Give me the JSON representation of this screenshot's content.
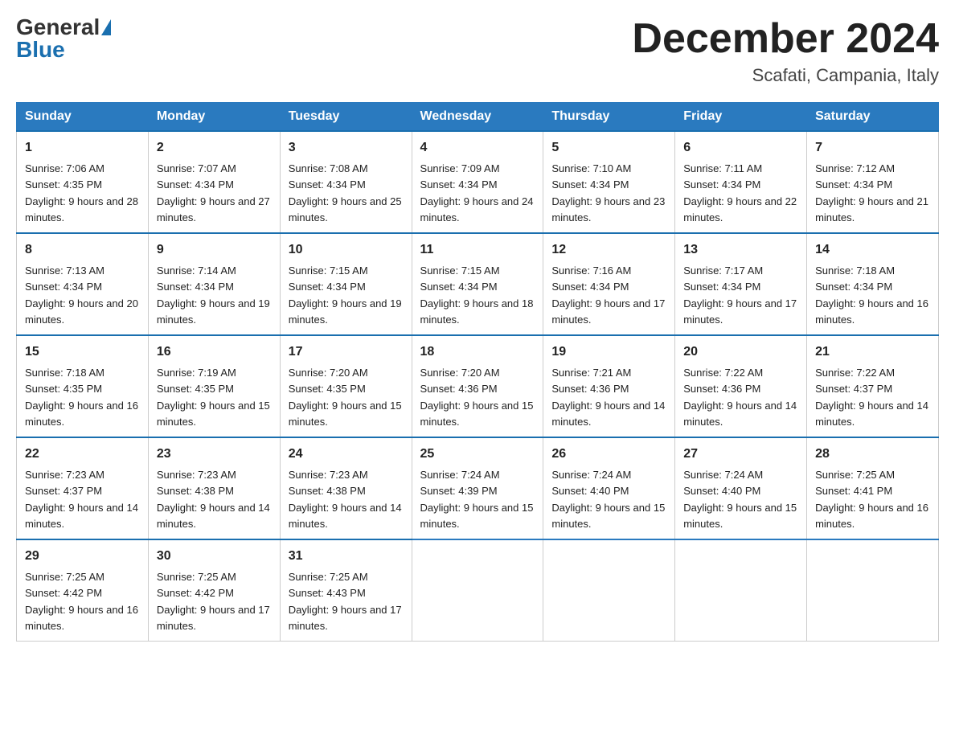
{
  "header": {
    "logo_general": "General",
    "logo_blue": "Blue",
    "month_title": "December 2024",
    "location": "Scafati, Campania, Italy"
  },
  "days_of_week": [
    "Sunday",
    "Monday",
    "Tuesday",
    "Wednesday",
    "Thursday",
    "Friday",
    "Saturday"
  ],
  "weeks": [
    [
      {
        "day": "1",
        "sunrise": "7:06 AM",
        "sunset": "4:35 PM",
        "daylight": "9 hours and 28 minutes."
      },
      {
        "day": "2",
        "sunrise": "7:07 AM",
        "sunset": "4:34 PM",
        "daylight": "9 hours and 27 minutes."
      },
      {
        "day": "3",
        "sunrise": "7:08 AM",
        "sunset": "4:34 PM",
        "daylight": "9 hours and 25 minutes."
      },
      {
        "day": "4",
        "sunrise": "7:09 AM",
        "sunset": "4:34 PM",
        "daylight": "9 hours and 24 minutes."
      },
      {
        "day": "5",
        "sunrise": "7:10 AM",
        "sunset": "4:34 PM",
        "daylight": "9 hours and 23 minutes."
      },
      {
        "day": "6",
        "sunrise": "7:11 AM",
        "sunset": "4:34 PM",
        "daylight": "9 hours and 22 minutes."
      },
      {
        "day": "7",
        "sunrise": "7:12 AM",
        "sunset": "4:34 PM",
        "daylight": "9 hours and 21 minutes."
      }
    ],
    [
      {
        "day": "8",
        "sunrise": "7:13 AM",
        "sunset": "4:34 PM",
        "daylight": "9 hours and 20 minutes."
      },
      {
        "day": "9",
        "sunrise": "7:14 AM",
        "sunset": "4:34 PM",
        "daylight": "9 hours and 19 minutes."
      },
      {
        "day": "10",
        "sunrise": "7:15 AM",
        "sunset": "4:34 PM",
        "daylight": "9 hours and 19 minutes."
      },
      {
        "day": "11",
        "sunrise": "7:15 AM",
        "sunset": "4:34 PM",
        "daylight": "9 hours and 18 minutes."
      },
      {
        "day": "12",
        "sunrise": "7:16 AM",
        "sunset": "4:34 PM",
        "daylight": "9 hours and 17 minutes."
      },
      {
        "day": "13",
        "sunrise": "7:17 AM",
        "sunset": "4:34 PM",
        "daylight": "9 hours and 17 minutes."
      },
      {
        "day": "14",
        "sunrise": "7:18 AM",
        "sunset": "4:34 PM",
        "daylight": "9 hours and 16 minutes."
      }
    ],
    [
      {
        "day": "15",
        "sunrise": "7:18 AM",
        "sunset": "4:35 PM",
        "daylight": "9 hours and 16 minutes."
      },
      {
        "day": "16",
        "sunrise": "7:19 AM",
        "sunset": "4:35 PM",
        "daylight": "9 hours and 15 minutes."
      },
      {
        "day": "17",
        "sunrise": "7:20 AM",
        "sunset": "4:35 PM",
        "daylight": "9 hours and 15 minutes."
      },
      {
        "day": "18",
        "sunrise": "7:20 AM",
        "sunset": "4:36 PM",
        "daylight": "9 hours and 15 minutes."
      },
      {
        "day": "19",
        "sunrise": "7:21 AM",
        "sunset": "4:36 PM",
        "daylight": "9 hours and 14 minutes."
      },
      {
        "day": "20",
        "sunrise": "7:22 AM",
        "sunset": "4:36 PM",
        "daylight": "9 hours and 14 minutes."
      },
      {
        "day": "21",
        "sunrise": "7:22 AM",
        "sunset": "4:37 PM",
        "daylight": "9 hours and 14 minutes."
      }
    ],
    [
      {
        "day": "22",
        "sunrise": "7:23 AM",
        "sunset": "4:37 PM",
        "daylight": "9 hours and 14 minutes."
      },
      {
        "day": "23",
        "sunrise": "7:23 AM",
        "sunset": "4:38 PM",
        "daylight": "9 hours and 14 minutes."
      },
      {
        "day": "24",
        "sunrise": "7:23 AM",
        "sunset": "4:38 PM",
        "daylight": "9 hours and 14 minutes."
      },
      {
        "day": "25",
        "sunrise": "7:24 AM",
        "sunset": "4:39 PM",
        "daylight": "9 hours and 15 minutes."
      },
      {
        "day": "26",
        "sunrise": "7:24 AM",
        "sunset": "4:40 PM",
        "daylight": "9 hours and 15 minutes."
      },
      {
        "day": "27",
        "sunrise": "7:24 AM",
        "sunset": "4:40 PM",
        "daylight": "9 hours and 15 minutes."
      },
      {
        "day": "28",
        "sunrise": "7:25 AM",
        "sunset": "4:41 PM",
        "daylight": "9 hours and 16 minutes."
      }
    ],
    [
      {
        "day": "29",
        "sunrise": "7:25 AM",
        "sunset": "4:42 PM",
        "daylight": "9 hours and 16 minutes."
      },
      {
        "day": "30",
        "sunrise": "7:25 AM",
        "sunset": "4:42 PM",
        "daylight": "9 hours and 17 minutes."
      },
      {
        "day": "31",
        "sunrise": "7:25 AM",
        "sunset": "4:43 PM",
        "daylight": "9 hours and 17 minutes."
      },
      null,
      null,
      null,
      null
    ]
  ]
}
